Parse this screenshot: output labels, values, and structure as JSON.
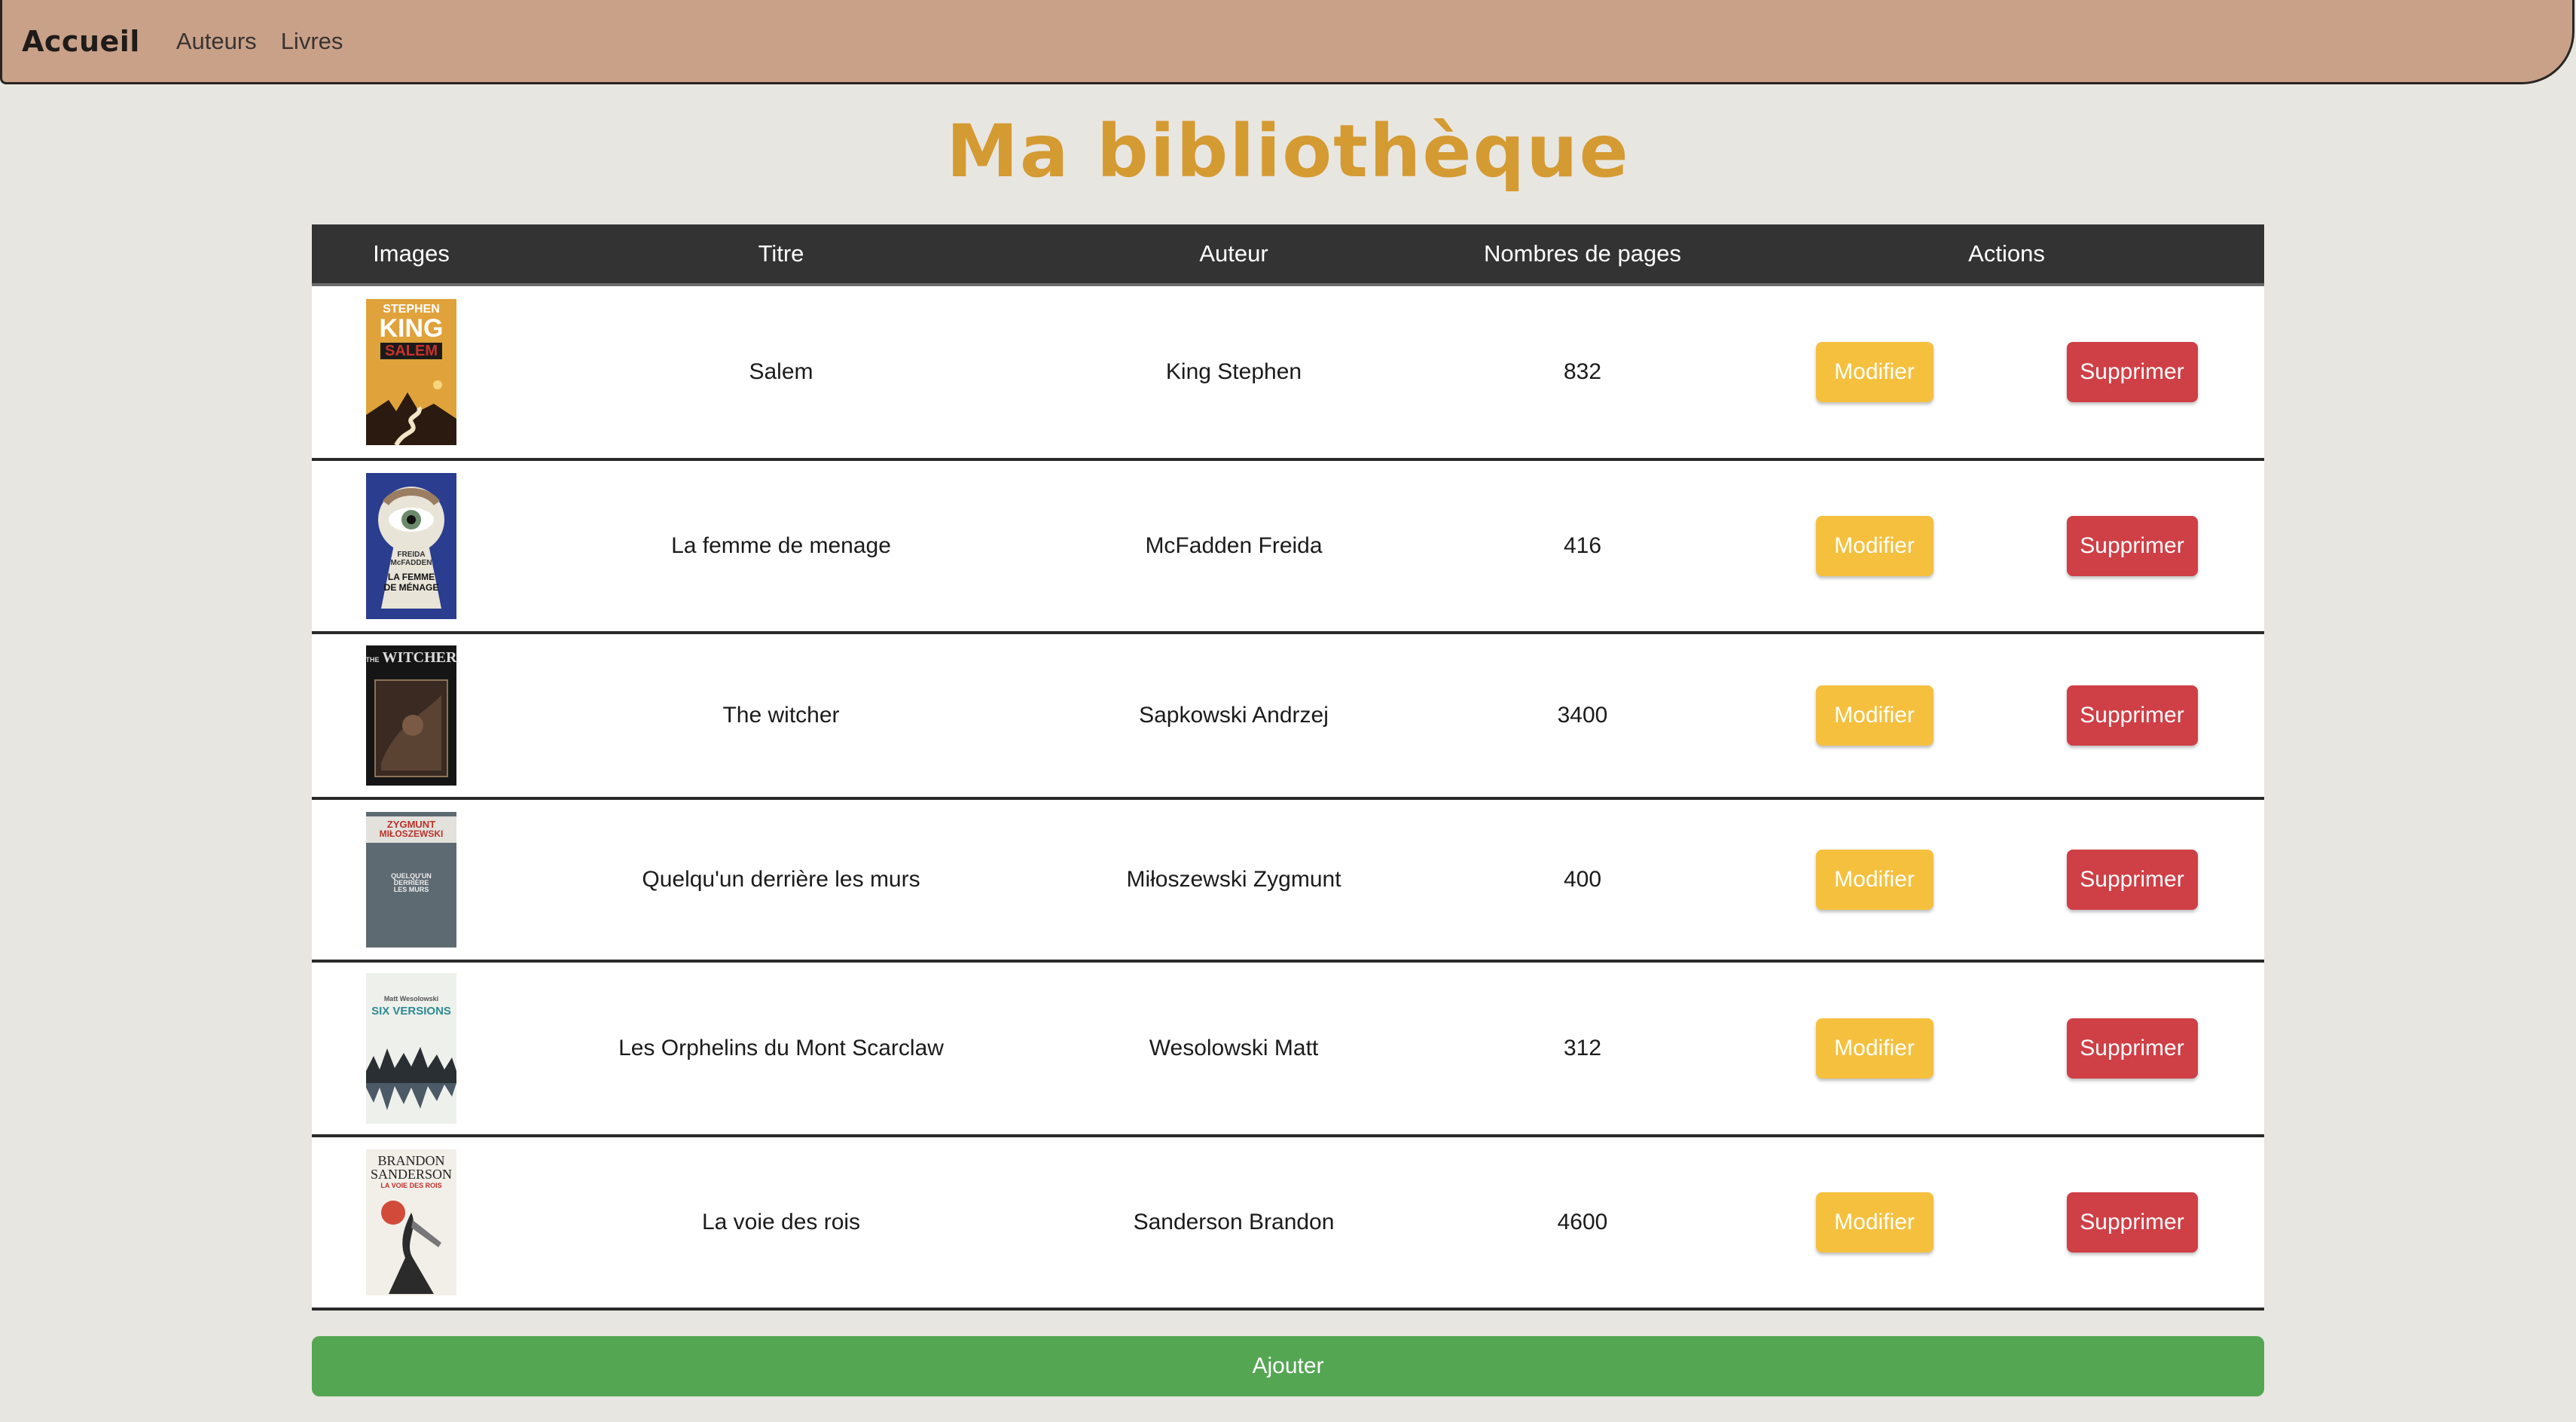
{
  "nav": {
    "brand": "Accueil",
    "links": [
      "Auteurs",
      "Livres"
    ]
  },
  "page": {
    "title": "Ma bibliothèque"
  },
  "table": {
    "headers": [
      "Images",
      "Titre",
      "Auteur",
      "Nombres de pages",
      "Actions"
    ],
    "rows": [
      {
        "cover_text": [
          "STEPHEN",
          "KING",
          "SALEM"
        ],
        "titre": "Salem",
        "auteur": "King Stephen",
        "pages": "832",
        "edit": "Modifier",
        "delete": "Supprimer"
      },
      {
        "cover_text": [
          "FREIDA",
          "McFADDEN",
          "LA FEMME",
          "DE MÉNAGE"
        ],
        "titre": "La femme de menage",
        "auteur": "McFadden Freida",
        "pages": "416",
        "edit": "Modifier",
        "delete": "Supprimer"
      },
      {
        "cover_text": [
          "THE",
          "WITCHER"
        ],
        "titre": "The witcher",
        "auteur": "Sapkowski Andrzej",
        "pages": "3400",
        "edit": "Modifier",
        "delete": "Supprimer"
      },
      {
        "cover_text": [
          "ZYGMUNT",
          "MIŁOSZEWSKI",
          "QUELQU'UN",
          "DERRIÈRE",
          "LES MURS"
        ],
        "titre": "Quelqu'un derrière les murs",
        "auteur": "Miłoszewski Zygmunt",
        "pages": "400",
        "edit": "Modifier",
        "delete": "Supprimer"
      },
      {
        "cover_text": [
          "Matt Wesolowski",
          "SIX VERSIONS"
        ],
        "titre": "Les Orphelins du Mont Scarclaw",
        "auteur": "Wesolowski Matt",
        "pages": "312",
        "edit": "Modifier",
        "delete": "Supprimer"
      },
      {
        "cover_text": [
          "BRANDON",
          "SANDERSON",
          "LA VOIE DES ROIS"
        ],
        "titre": "La voie des rois",
        "auteur": "Sanderson Brandon",
        "pages": "4600",
        "edit": "Modifier",
        "delete": "Supprimer"
      }
    ]
  },
  "add_button": "Ajouter",
  "colors": {
    "nav_bg": "#c9a189",
    "title": "#d49b32",
    "edit": "#f5c03e",
    "delete": "#cf3f46",
    "add": "#54a653"
  }
}
